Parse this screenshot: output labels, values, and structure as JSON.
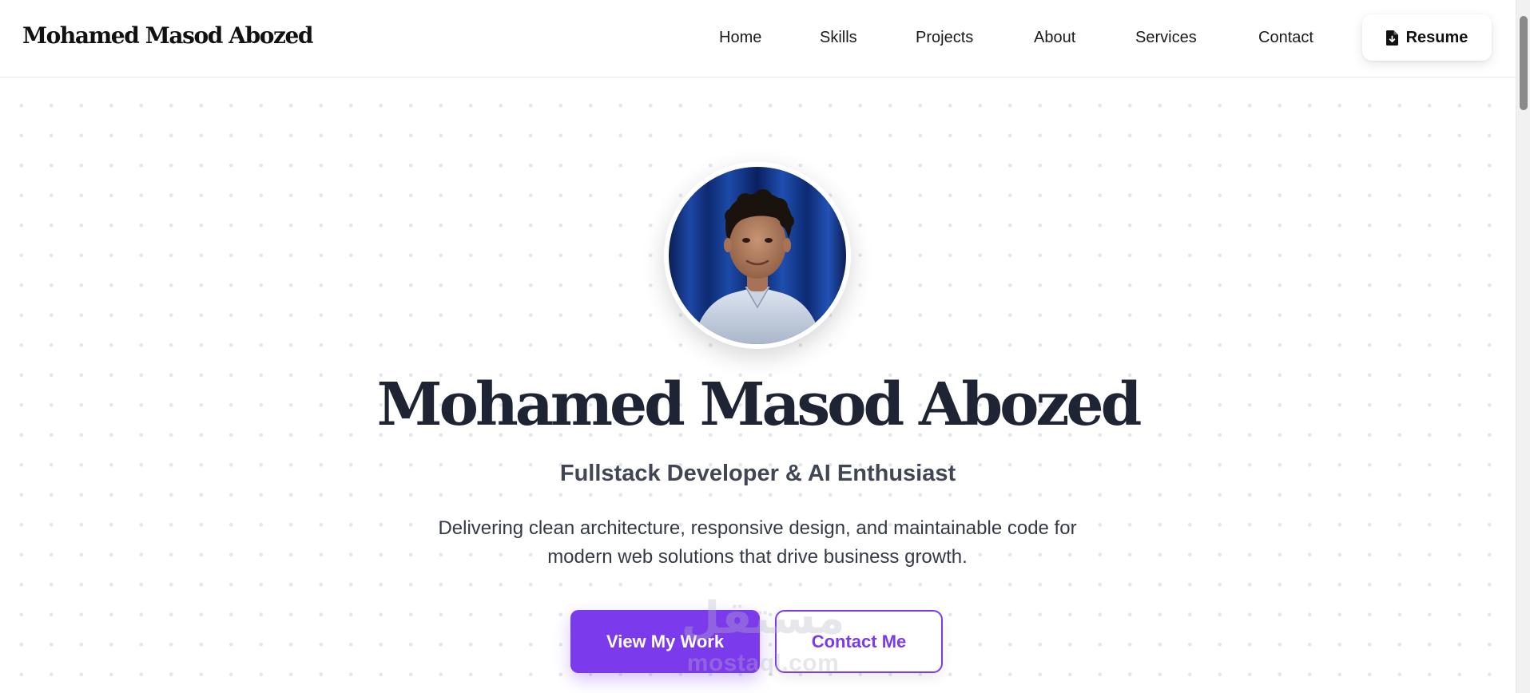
{
  "header": {
    "brand": "Mohamed Masod Abozed",
    "nav": [
      {
        "label": "Home"
      },
      {
        "label": "Skills"
      },
      {
        "label": "Projects"
      },
      {
        "label": "About"
      },
      {
        "label": "Services"
      },
      {
        "label": "Contact"
      }
    ],
    "resume_label": "Resume",
    "resume_icon": "file-download-icon"
  },
  "hero": {
    "avatar_icon": "profile-photo",
    "name": "Mohamed Masod Abozed",
    "subtitle": "Fullstack Developer & AI Enthusiast",
    "description": "Delivering clean architecture, responsive design, and maintainable code for modern web solutions that drive business growth.",
    "primary_cta": "View My Work",
    "secondary_cta": "Contact Me"
  },
  "watermark": {
    "arabic": "مستقل",
    "latin": "mostaql.com"
  },
  "colors": {
    "accent": "#7c3aed",
    "heading": "#1e2433",
    "text": "#343a46"
  }
}
